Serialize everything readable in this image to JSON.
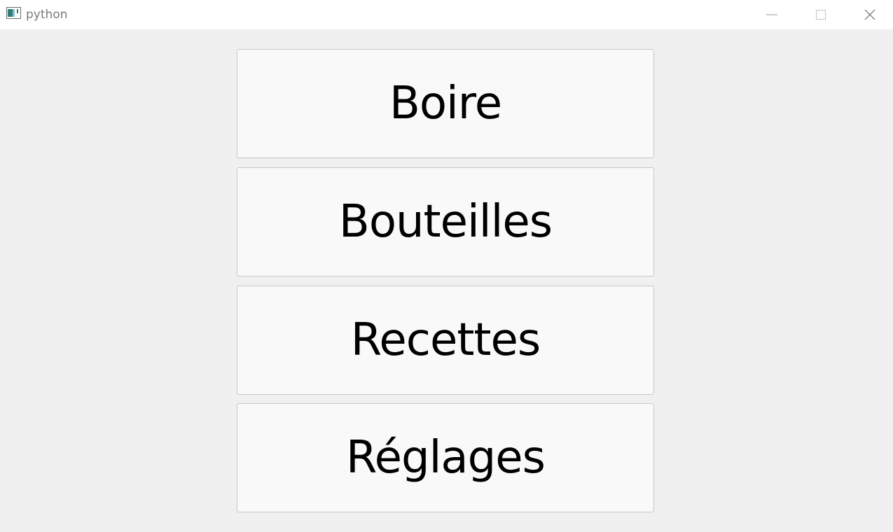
{
  "window": {
    "title": "python",
    "icon": "app-window-icon",
    "controls": {
      "minimize_icon": "minimize-icon",
      "maximize_icon": "maximize-icon",
      "close_icon": "close-icon"
    }
  },
  "menu": {
    "buttons": [
      {
        "label": "Boire"
      },
      {
        "label": "Bouteilles"
      },
      {
        "label": "Recettes"
      },
      {
        "label": "Réglages"
      }
    ]
  },
  "colors": {
    "background": "#f0f0f0",
    "titlebar": "#ffffff",
    "button_face": "#f9f9f9",
    "button_border": "#c8c8c8",
    "text": "#000000"
  }
}
